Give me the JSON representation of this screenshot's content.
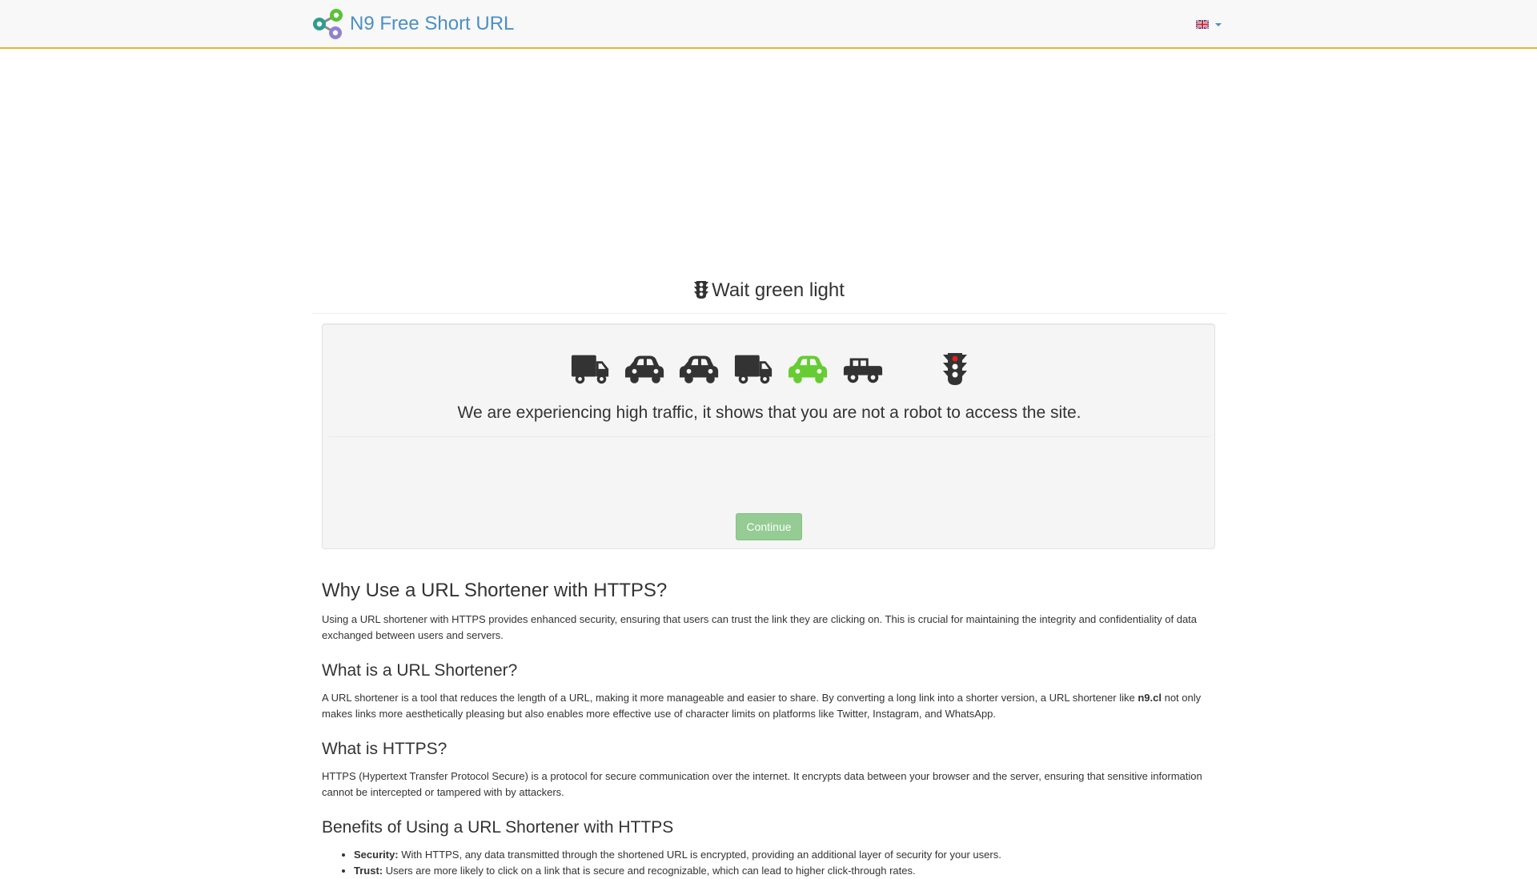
{
  "navbar": {
    "brand": "N9 Free Short URL",
    "language": {
      "icon": "uk-flag-icon"
    }
  },
  "header": {
    "title": "Wait green light",
    "icon": "traffic-light-icon"
  },
  "wait": {
    "vehicles": [
      {
        "icon": "truck-icon",
        "color": "#333333"
      },
      {
        "icon": "car-icon",
        "color": "#333333"
      },
      {
        "icon": "car-icon",
        "color": "#333333"
      },
      {
        "icon": "truck-icon",
        "color": "#333333"
      },
      {
        "icon": "car-icon",
        "color": "#66cc33"
      },
      {
        "icon": "jeep-icon",
        "color": "#333333"
      }
    ],
    "light_state": "red",
    "message": "We are experiencing high traffic, it shows that you are not a robot to access the site.",
    "continue_label": "Continue"
  },
  "article": {
    "h_why": "Why Use a URL Shortener with HTTPS?",
    "p_why": "Using a URL shortener with HTTPS provides enhanced security, ensuring that users can trust the link they are clicking on. This is crucial for maintaining the integrity and confidentiality of data exchanged between users and servers.",
    "h_what": "What is a URL Shortener?",
    "p_what_1": "A URL shortener is a tool that reduces the length of a URL, making it more manageable and easier to share. By converting a long link into a shorter version, a URL shortener like ",
    "p_what_bold": "n9.cl",
    "p_what_2": " not only makes links more aesthetically pleasing but also enables more effective use of character limits on platforms like Twitter, Instagram, and WhatsApp.",
    "h_https": "What is HTTPS?",
    "p_https": "HTTPS (Hypertext Transfer Protocol Secure) is a protocol for secure communication over the internet. It encrypts data between your browser and the server, ensuring that sensitive information cannot be intercepted or tampered with by attackers.",
    "h_benefits": "Benefits of Using a URL Shortener with HTTPS",
    "benefits": [
      {
        "label": "Security:",
        "text": " With HTTPS, any data transmitted through the shortened URL is encrypted, providing an additional layer of security for your users."
      },
      {
        "label": "Trust:",
        "text": " Users are more likely to click on a link that is secure and recognizable, which can lead to higher click-through rates."
      }
    ]
  }
}
